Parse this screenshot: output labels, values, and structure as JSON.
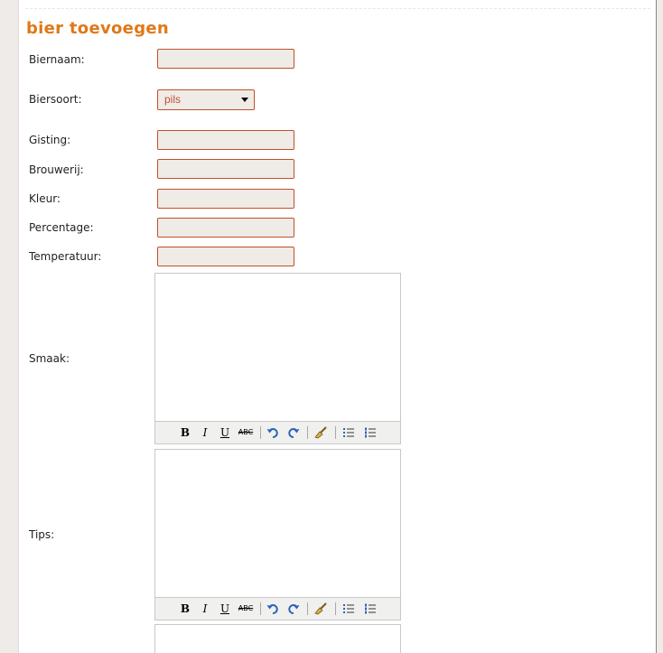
{
  "form": {
    "title": "bier toevoegen",
    "fields": {
      "biernaam": {
        "label": "Biernaam:",
        "value": ""
      },
      "biersoort": {
        "label": "Biersoort:",
        "selected": "pils"
      },
      "gisting": {
        "label": "Gisting:",
        "value": ""
      },
      "brouwerij": {
        "label": "Brouwerij:",
        "value": ""
      },
      "kleur": {
        "label": "Kleur:",
        "value": ""
      },
      "percentage": {
        "label": "Percentage:",
        "value": ""
      },
      "temperatuur": {
        "label": "Temperatuur:",
        "value": ""
      },
      "smaak": {
        "label": "Smaak:"
      },
      "tips": {
        "label": "Tips:"
      }
    },
    "toolbar": {
      "bold": "B",
      "italic": "I",
      "underline": "U",
      "strikethrough": "ABC",
      "icons": [
        "undo-icon",
        "redo-icon",
        "cleanup-brush-icon",
        "bulleted-list-icon",
        "numbered-list-icon"
      ]
    }
  },
  "colors": {
    "title": "#e07818",
    "input_border": "#c0502a",
    "input_bg": "#efebe7",
    "sidebar": "#eeebe8"
  }
}
